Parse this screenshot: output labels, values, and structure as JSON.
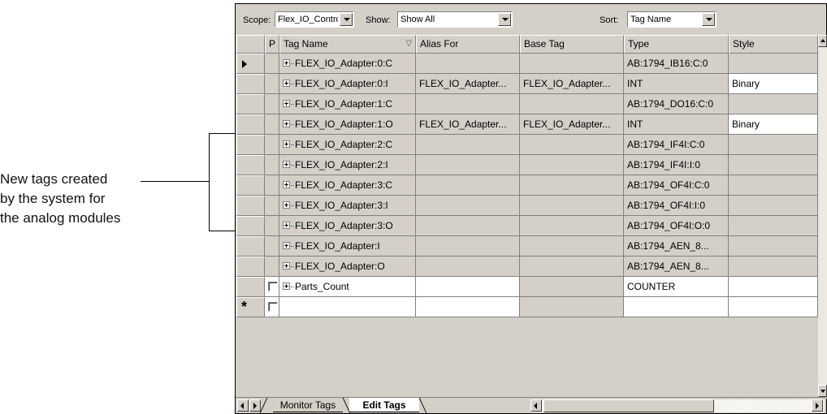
{
  "callout": {
    "lines": [
      "New tags created",
      "by the system for",
      "the analog modules"
    ]
  },
  "toolbar": {
    "scope_label": "Scope:",
    "scope_value": "Flex_IO_Controller(c",
    "show_label": "Show:",
    "show_value": "Show All",
    "sort_label": "Sort:",
    "sort_value": "Tag Name"
  },
  "grid": {
    "headers": {
      "p": "P",
      "tag_name": "Tag Name",
      "sort_indicator": "▽",
      "alias_for": "Alias For",
      "base_tag": "Base Tag",
      "type": "Type",
      "style": "Style"
    },
    "rows": [
      {
        "tag": "FLEX_IO_Adapter:0:C",
        "alias": "",
        "base": "",
        "type": "AB:1794_IB16:C:0",
        "style": ""
      },
      {
        "tag": "FLEX_IO_Adapter:0:I",
        "alias": "FLEX_IO_Adapter...",
        "base": "FLEX_IO_Adapter...",
        "type": "INT",
        "style": "Binary"
      },
      {
        "tag": "FLEX_IO_Adapter:1:C",
        "alias": "",
        "base": "",
        "type": "AB:1794_DO16:C:0",
        "style": ""
      },
      {
        "tag": "FLEX_IO_Adapter:1:O",
        "alias": "FLEX_IO_Adapter...",
        "base": "FLEX_IO_Adapter...",
        "type": "INT",
        "style": "Binary"
      },
      {
        "tag": "FLEX_IO_Adapter:2:C",
        "alias": "",
        "base": "",
        "type": "AB:1794_IF4I:C:0",
        "style": ""
      },
      {
        "tag": "FLEX_IO_Adapter:2:I",
        "alias": "",
        "base": "",
        "type": "AB:1794_IF4I:I:0",
        "style": ""
      },
      {
        "tag": "FLEX_IO_Adapter:3:C",
        "alias": "",
        "base": "",
        "type": "AB:1794_OF4I:C:0",
        "style": ""
      },
      {
        "tag": "FLEX_IO_Adapter:3:I",
        "alias": "",
        "base": "",
        "type": "AB:1794_OF4I:I:0",
        "style": ""
      },
      {
        "tag": "FLEX_IO_Adapter:3:O",
        "alias": "",
        "base": "",
        "type": "AB:1794_OF4I:O:0",
        "style": ""
      },
      {
        "tag": "FLEX_IO_Adapter:I",
        "alias": "",
        "base": "",
        "type": "AB:1794_AEN_8...",
        "style": ""
      },
      {
        "tag": "FLEX_IO_Adapter:O",
        "alias": "",
        "base": "",
        "type": "AB:1794_AEN_8...",
        "style": ""
      },
      {
        "tag": "Parts_Count",
        "alias": "",
        "base": "",
        "type": "COUNTER",
        "style": ""
      }
    ],
    "new_row_marker": "*"
  },
  "tabs": {
    "monitor": "Monitor Tags",
    "edit": "Edit Tags"
  }
}
